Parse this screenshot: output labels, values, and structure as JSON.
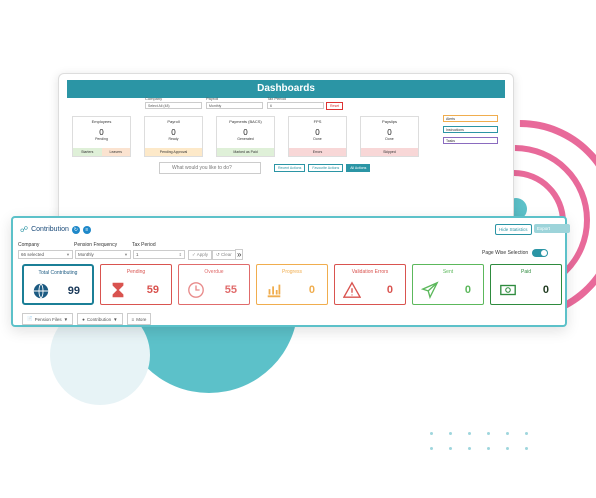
{
  "dashboard": {
    "title": "Dashboards",
    "filters": [
      {
        "label": "Company",
        "value": "Select All (48)"
      },
      {
        "label": "Payroll",
        "value": "Monthly"
      },
      {
        "label": "Tax Period",
        "value": "6"
      }
    ],
    "reset_label": "Reset",
    "cards": [
      {
        "title": "Employees",
        "value": "0",
        "sub": "Pending",
        "bottom_left": "Starters",
        "bottom_right": "Leavers",
        "color": "#5cb85c"
      },
      {
        "title": "Payroll",
        "value": "0",
        "sub": "Ready",
        "bottom": "Pending Approval",
        "color": "#f0ad4e"
      },
      {
        "title": "Payments (BACS)",
        "value": "0",
        "sub": "Generated",
        "bottom": "Marked as Paid",
        "color": "#5cb85c"
      },
      {
        "title": "FPS",
        "value": "0",
        "sub": "Done",
        "bottom": "Errors",
        "color": "#d9534f"
      },
      {
        "title": "Payslips",
        "value": "0",
        "sub": "Done",
        "bottom": "Skipped",
        "color": "#d9534f"
      }
    ],
    "side": [
      "Alerts",
      "Instructions",
      "Tasks"
    ],
    "ask_placeholder": "What would you like to do?",
    "buttons": [
      "Recent Actions",
      "Favourite Actions",
      "All Actions"
    ]
  },
  "panel": {
    "title": "Contribution",
    "hide_label": "Hide Statistics",
    "export_label": "Export",
    "filters": {
      "company_label": "Company",
      "company_value": "66 selected",
      "frequency_label": "Pension Frequency",
      "frequency_value": "Monthly",
      "period_label": "Tax Period",
      "period_value": "1"
    },
    "apply_label": "Apply",
    "clear_label": "Clear",
    "next_glyph": "»",
    "page_wise_label": "Page Wise Selection",
    "cards": [
      {
        "title": "Total Contributing",
        "value": "99",
        "icon": "globe-icon",
        "color": "#1b5a82",
        "title_color": "#1b5a82"
      },
      {
        "title": "Pending",
        "value": "59",
        "icon": "hourglass-icon",
        "color": "#d9534f",
        "title_color": "#d9534f"
      },
      {
        "title": "Overdue",
        "value": "55",
        "icon": "clock-icon",
        "color": "#e88b8b",
        "title_color": "#e06b6b"
      },
      {
        "title": "Progress",
        "value": "0",
        "icon": "bar-chart-icon",
        "color": "#f0ad4e",
        "title_color": "#f0ad4e"
      },
      {
        "title": "Validation Errors",
        "value": "0",
        "icon": "warning-icon",
        "color": "#d9534f",
        "title_color": "#d9534f"
      },
      {
        "title": "Sent",
        "value": "0",
        "icon": "send-icon",
        "color": "#5cb85c",
        "title_color": "#5cb85c"
      },
      {
        "title": "Paid",
        "value": "0",
        "icon": "banknote-icon",
        "color": "#2e8b3e",
        "title_color": "#2e8b3e"
      }
    ],
    "bottom": [
      {
        "label": "Pension Files",
        "icon": "file-icon"
      },
      {
        "label": "Contribution",
        "icon": "coins-icon"
      },
      {
        "label": "More",
        "icon": "more-icon"
      }
    ]
  }
}
